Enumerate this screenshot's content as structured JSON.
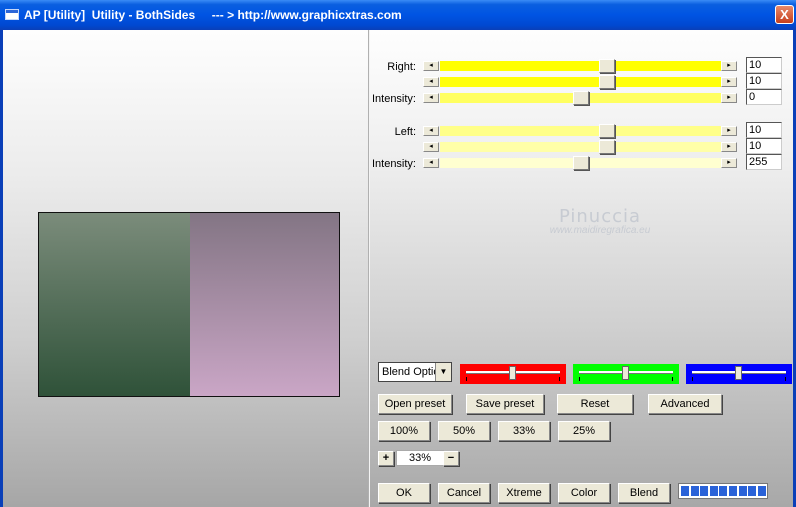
{
  "window": {
    "title": "AP [Utility]  Utility - BothSides     --- > http://www.graphicxtras.com",
    "close_label": "X"
  },
  "right_section": {
    "label_right": "Right:",
    "label_intensity": "Intensity:",
    "sliders": [
      {
        "value": "10",
        "level": 0.6,
        "color": "#ffff00"
      },
      {
        "value": "10",
        "level": 0.6,
        "color": "#ffff0a"
      },
      {
        "value": "0",
        "level": 0.5,
        "color": "#ffff60"
      }
    ]
  },
  "left_section": {
    "label_left": "Left:",
    "label_intensity": "Intensity:",
    "sliders": [
      {
        "value": "10",
        "level": 0.6,
        "color": "#ffff88"
      },
      {
        "value": "10",
        "level": 0.6,
        "color": "#ffffa8"
      },
      {
        "value": "255",
        "level": 0.5,
        "color": "#ffffd0"
      }
    ]
  },
  "watermark": {
    "name": "Pinuccia",
    "url": "www.maidiregrafica.eu"
  },
  "blend_select": {
    "value": "Blend Options"
  },
  "color_sliders": [
    {
      "name": "red",
      "color": "#ff0000",
      "level": 0.5
    },
    {
      "name": "green",
      "color": "#00ff00",
      "level": 0.5
    },
    {
      "name": "blue",
      "color": "#0000ff",
      "level": 0.5
    }
  ],
  "buttons": {
    "open_preset": "Open preset",
    "save_preset": "Save preset",
    "reset": "Reset",
    "advanced": "Advanced",
    "zoom_100": "100%",
    "zoom_50": "50%",
    "zoom_33": "33%",
    "zoom_25": "25%",
    "zoom_in": "+",
    "zoom_out": "−",
    "ok": "OK",
    "cancel": "Cancel",
    "xtreme": "Xtreme",
    "color": "Color",
    "blend": "Blend"
  },
  "zoom_value": "33%",
  "progress_blocks": 9
}
